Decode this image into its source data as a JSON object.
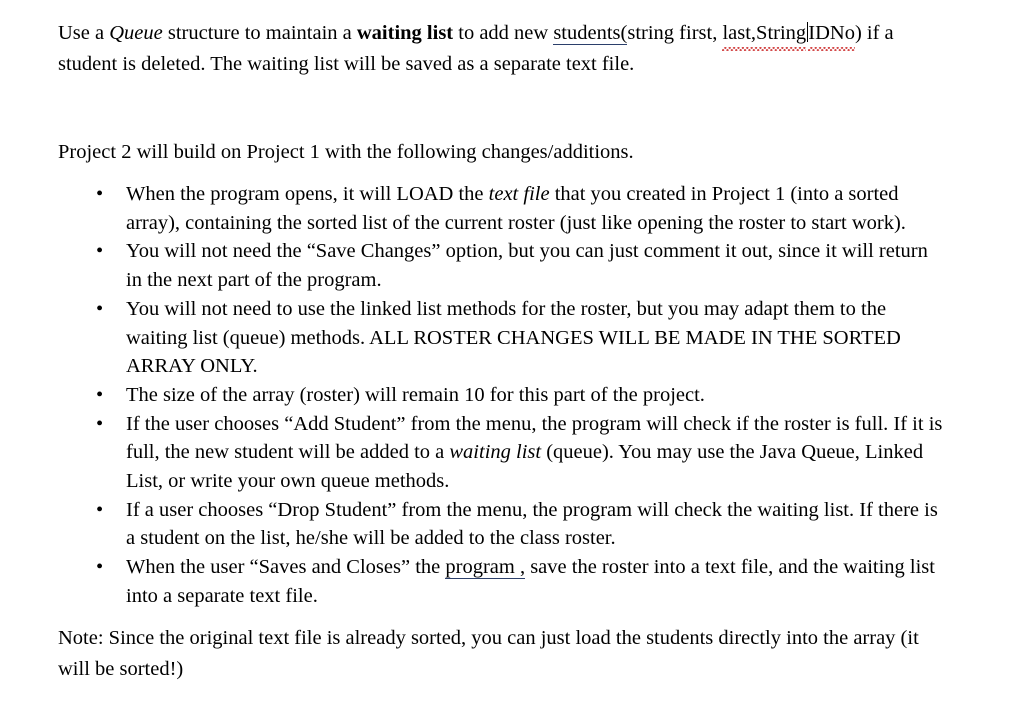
{
  "document": {
    "intro": {
      "seg_1": "Use a ",
      "seg_queue_italic": "Queue",
      "seg_2": " structure to maintain a ",
      "seg_waiting_list_bold": "waiting list",
      "seg_3": " to add new ",
      "seg_students_underlined": "students(",
      "seg_4": "string first, ",
      "seg_misspelled_last_string": "last,String",
      "seg_5": "",
      "seg_idno_misspelled": "IDNo",
      "seg_6": ") if a student is deleted. The waiting list will be saved as a separate text file."
    },
    "overview_paragraph": "Project 2 will build on Project 1 with the following changes/additions.",
    "bullet_marker": "•",
    "bullets": [
      {
        "id": "load-text-file",
        "part_1": "When the program opens, it will LOAD the ",
        "italic": "text file",
        "part_2": " that you created in Project 1 (into a sorted array), containing the sorted list of the current roster (just like opening the roster to start work)."
      },
      {
        "id": "save-changes-option",
        "part_1": "You will not need the “Save Changes” option, but you can just comment it out, since it will return in the next part of the program.",
        "italic": "",
        "part_2": ""
      },
      {
        "id": "linked-list-methods",
        "part_1": "You will not need to use the linked list methods for the roster, but you may adapt them to the waiting list (queue) methods.  ALL ROSTER CHANGES WILL BE MADE IN THE SORTED ARRAY ONLY.",
        "italic": "",
        "part_2": ""
      },
      {
        "id": "array-size",
        "part_1": "The size of the array (roster) will remain 10 for this part of the project.",
        "italic": "",
        "part_2": ""
      },
      {
        "id": "add-student",
        "part_1": "If the user chooses “Add Student” from the menu, the program will check if the roster is full.  If it is full, the new student will be added to a ",
        "italic": "waiting list",
        "part_2": " (queue).  You may use the Java Queue, Linked List, or write your own queue methods."
      },
      {
        "id": "drop-student",
        "part_1": "If a user chooses “Drop Student” from the menu, the program will check the waiting list. If there is a student on the list, he/she will be added to the class roster.",
        "italic": "",
        "part_2": ""
      },
      {
        "id": "saves-and-closes",
        "part_1": "When the user “Saves and Closes” the ",
        "underlined": "program ,",
        "part_2": " save the roster into a text file, and the waiting list into a separate text file."
      }
    ],
    "note_paragraph": "Note: Since the original text file is already sorted, you can just load the students directly into the array (it will be sorted!)"
  },
  "colors": {
    "page_background": "#ffffff",
    "text": "#000000",
    "spellcheck_underline": "#d34a4a",
    "link_underline": "#2b3f6b",
    "caret": "#000000"
  }
}
